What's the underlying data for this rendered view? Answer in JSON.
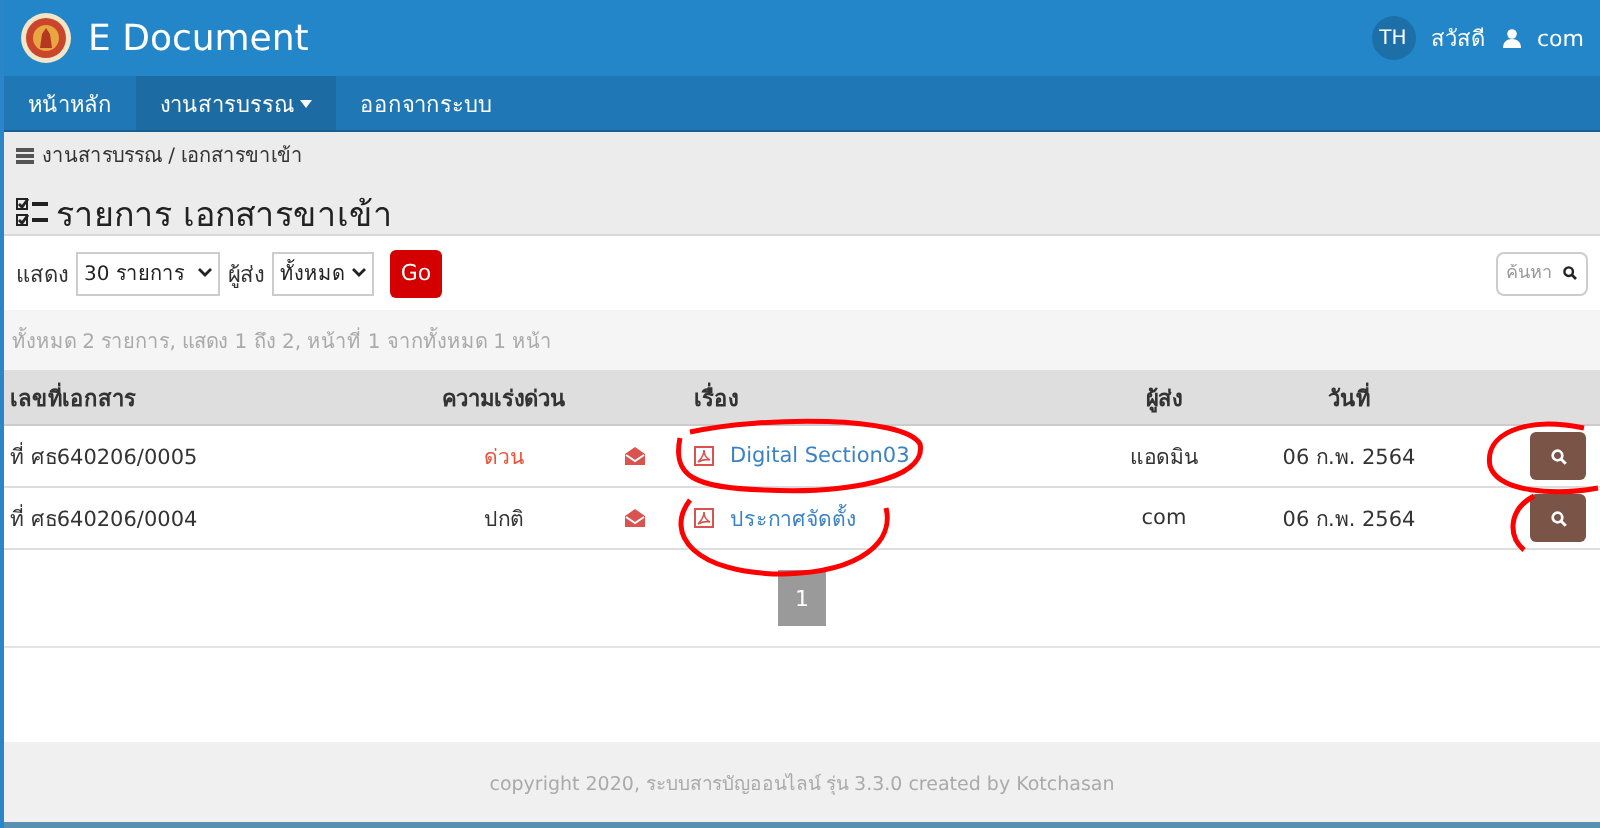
{
  "header": {
    "title": "E Document",
    "language": "TH",
    "greeting": "สวัสดี",
    "user": "com"
  },
  "nav": [
    {
      "label": "หน้าหลัก",
      "selected": false,
      "dropdown": false
    },
    {
      "label": "งานสารบรรณ",
      "selected": true,
      "dropdown": true
    },
    {
      "label": "ออกจากระบบ",
      "selected": false,
      "dropdown": false
    }
  ],
  "breadcrumb": "งานสารบรรณ / เอกสารขาเข้า",
  "page_title": "รายการ เอกสารขาเข้า",
  "filters": {
    "show_label": "แสดง",
    "show_value": "30 รายการ",
    "sender_label": "ผู้ส่ง",
    "sender_value": "ทั้งหมด",
    "go": "Go",
    "search_placeholder": "ค้นหา"
  },
  "summary": "ทั้งหมด 2 รายการ, แสดง 1 ถึง 2, หน้าที่ 1 จากทั้งหมด 1 หน้า",
  "table": {
    "columns": [
      "เลขที่เอกสาร",
      "ความเร่งด่วน",
      "เรื่อง",
      "ผู้ส่ง",
      "วันที่"
    ],
    "rows": [
      {
        "number": "ที่ ศธ640206/0005",
        "urgency": "ด่วน",
        "urgent": true,
        "subject": "Digital Section03",
        "sender": "แอดมิน",
        "date": "06 ก.พ. 2564"
      },
      {
        "number": "ที่ ศธ640206/0004",
        "urgency": "ปกติ",
        "urgent": false,
        "subject": "ประกาศจัดตั้ง",
        "sender": "com",
        "date": "06 ก.พ. 2564"
      }
    ]
  },
  "pagination": [
    {
      "label": "1",
      "selected": true
    }
  ],
  "footer": "copyright 2020, ระบบสารบัญออนไลน์ รุ่น 3.3.0 created by Kotchasan"
}
